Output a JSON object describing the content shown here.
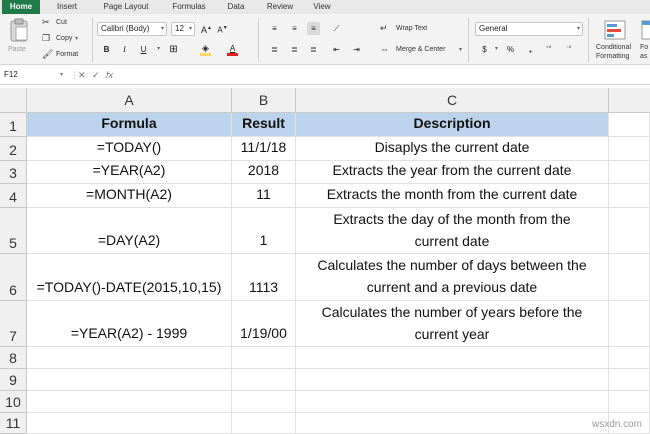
{
  "ribbon": {
    "tabs": [
      "Home",
      "Insert",
      "Page Layout",
      "Formulas",
      "Data",
      "Review",
      "View"
    ],
    "clipboard": {
      "paste": "Paste",
      "cut": "Cut",
      "copy": "Copy",
      "format": "Format"
    },
    "font": {
      "name": "Calibri (Body)",
      "size": "12"
    },
    "alignment": {
      "wrap_text": "Wrap Text",
      "merge_center": "Merge & Center"
    },
    "number": {
      "format": "General"
    },
    "styles": {
      "conditional_1": "Conditional",
      "conditional_2": "Formatting",
      "fo": "Fo",
      "as": "as"
    }
  },
  "formula_bar": {
    "name_box": "F12",
    "fx": "fx",
    "content": ""
  },
  "columns": [
    "A",
    "B",
    "C"
  ],
  "rows": [
    {
      "num": "1",
      "a": "Formula",
      "b": "Result",
      "c": [
        "Description"
      ],
      "header": true
    },
    {
      "num": "2",
      "a": "=TODAY()",
      "b": "11/1/18",
      "c": [
        "Disaplys the current date"
      ]
    },
    {
      "num": "3",
      "a": "=YEAR(A2)",
      "b": "2018",
      "c": [
        "Extracts the year from the current date"
      ]
    },
    {
      "num": "4",
      "a": "=MONTH(A2)",
      "b": "11",
      "c": [
        "Extracts the month from the current date"
      ]
    },
    {
      "num": "5",
      "a": "=DAY(A2)",
      "b": "1",
      "c": [
        "Extracts the day of the month from the",
        "current date"
      ]
    },
    {
      "num": "6",
      "a": "=TODAY()-DATE(2015,10,15)",
      "b": "1113",
      "c": [
        "Calculates the number of days between the",
        "current and a previous date"
      ]
    },
    {
      "num": "7",
      "a": "=YEAR(A2) - 1999",
      "b": "1/19/00",
      "c": [
        "Calculates the number of years before the",
        "current year"
      ]
    },
    {
      "num": "8",
      "a": "",
      "b": "",
      "c": [
        ""
      ]
    },
    {
      "num": "9",
      "a": "",
      "b": "",
      "c": [
        ""
      ]
    },
    {
      "num": "10",
      "a": "",
      "b": "",
      "c": [
        ""
      ]
    },
    {
      "num": "11",
      "a": "",
      "b": "",
      "c": [
        ""
      ]
    }
  ],
  "watermark": "wsxdn.com"
}
